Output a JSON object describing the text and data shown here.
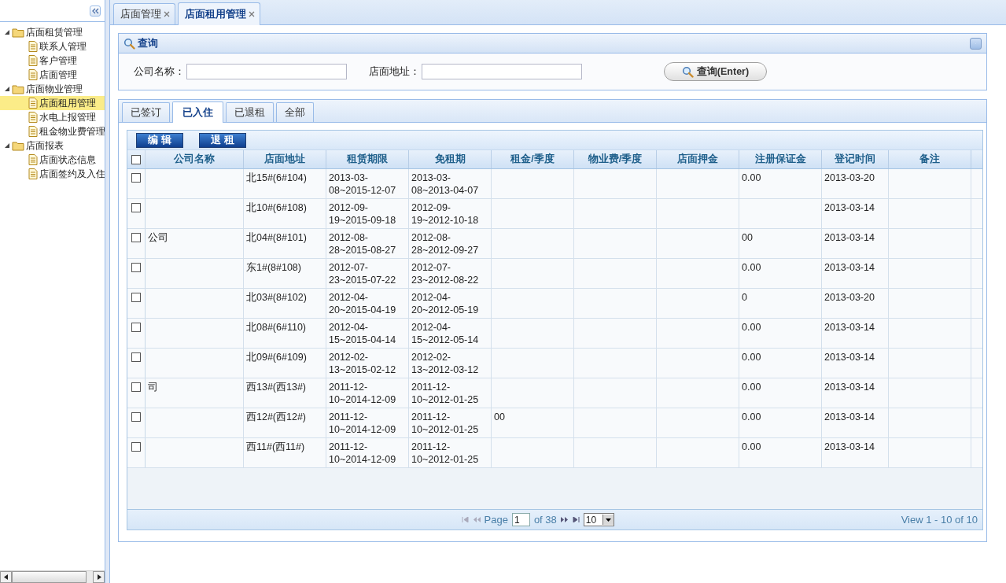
{
  "sidebar": {
    "tree": [
      {
        "label": "店面租赁管理",
        "expanded": true,
        "children": [
          {
            "label": "联系人管理",
            "selected": false
          },
          {
            "label": "客户管理",
            "selected": false
          },
          {
            "label": "店面管理",
            "selected": false
          }
        ]
      },
      {
        "label": "店面物业管理",
        "expanded": true,
        "children": [
          {
            "label": "店面租用管理",
            "selected": true
          },
          {
            "label": "水电上报管理",
            "selected": false
          },
          {
            "label": "租金物业费管理",
            "selected": false
          }
        ]
      },
      {
        "label": "店面报表",
        "expanded": true,
        "children": [
          {
            "label": "店面状态信息",
            "selected": false
          },
          {
            "label": "店面签约及入住",
            "selected": false
          }
        ]
      }
    ]
  },
  "page_tabs": [
    {
      "label": "店面管理",
      "selected": false
    },
    {
      "label": "店面租用管理",
      "selected": true
    }
  ],
  "query_panel": {
    "title": "查询",
    "fields": [
      {
        "label": "公司名称："
      },
      {
        "label": "店面地址："
      }
    ],
    "button": "查询(Enter)"
  },
  "status_tabs": [
    {
      "label": "已签订",
      "selected": false
    },
    {
      "label": "已入住",
      "selected": true
    },
    {
      "label": "已退租",
      "selected": false
    },
    {
      "label": "全部",
      "selected": false
    }
  ],
  "toolbar_buttons": [
    "编 辑",
    "退 租"
  ],
  "table": {
    "select_all": false,
    "columns": [
      "公司名称",
      "店面地址",
      "租赁期限",
      "免租期",
      "租金/季度",
      "物业费/季度",
      "店面押金",
      "注册保证金",
      "登记时间",
      "备注"
    ],
    "rows": [
      {
        "checked": false,
        "address": "北15#(6#104)",
        "lease_term": "2013-03-08~2015-12-07",
        "rent_free": "2013-03-08~2013-04-07",
        "bond": "0.00",
        "date": "2013-03-20"
      },
      {
        "checked": false,
        "address": "北10#(6#108)",
        "lease_term": "2012-09-19~2015-09-18",
        "rent_free": "2012-09-19~2012-10-18",
        "date": "2013-03-14"
      },
      {
        "checked": false,
        "company": "公司",
        "address": "北04#(8#101)",
        "lease_term": "2012-08-28~2015-08-27",
        "rent_free": "2012-08-28~2012-09-27",
        "bond": "00",
        "date": "2013-03-14"
      },
      {
        "checked": false,
        "address": "东1#(8#108)",
        "lease_term": "2012-07-23~2015-07-22",
        "rent_free": "2012-07-23~2012-08-22",
        "bond": "0.00",
        "date": "2013-03-14"
      },
      {
        "checked": false,
        "address": "北03#(8#102)",
        "lease_term": "2012-04-20~2015-04-19",
        "rent_free": "2012-04-20~2012-05-19",
        "bond": "0",
        "date": "2013-03-20"
      },
      {
        "checked": false,
        "address": "北08#(6#110)",
        "lease_term": "2012-04-15~2015-04-14",
        "rent_free": "2012-04-15~2012-05-14",
        "bond": "0.00",
        "date": "2013-03-14"
      },
      {
        "checked": false,
        "address": "北09#(6#109)",
        "lease_term": "2012-02-13~2015-02-12",
        "rent_free": "2012-02-13~2012-03-12",
        "bond": "0.00",
        "date": "2013-03-14"
      },
      {
        "checked": false,
        "company": "司",
        "address": "西13#(西13#)",
        "lease_term": "2011-12-10~2014-12-09",
        "rent_free": "2011-12-10~2012-01-25",
        "bond": "0.00",
        "date": "2013-03-14"
      },
      {
        "checked": false,
        "address": "西12#(西12#)",
        "lease_term": "2011-12-10~2014-12-09",
        "rent_free": "2011-12-10~2012-01-25",
        "rent": "00",
        "bond": "0.00",
        "date": "2013-03-14"
      },
      {
        "checked": false,
        "address": "西11#(西11#)",
        "lease_term": "2011-12-10~2014-12-09",
        "rent_free": "2011-12-10~2012-01-25",
        "bond": "0.00",
        "date": "2013-03-14"
      }
    ]
  },
  "pager": {
    "page_label": "Page",
    "page": "1",
    "total": "of 38",
    "page_size": "10",
    "summary": "View 1 - 10 of 10"
  }
}
